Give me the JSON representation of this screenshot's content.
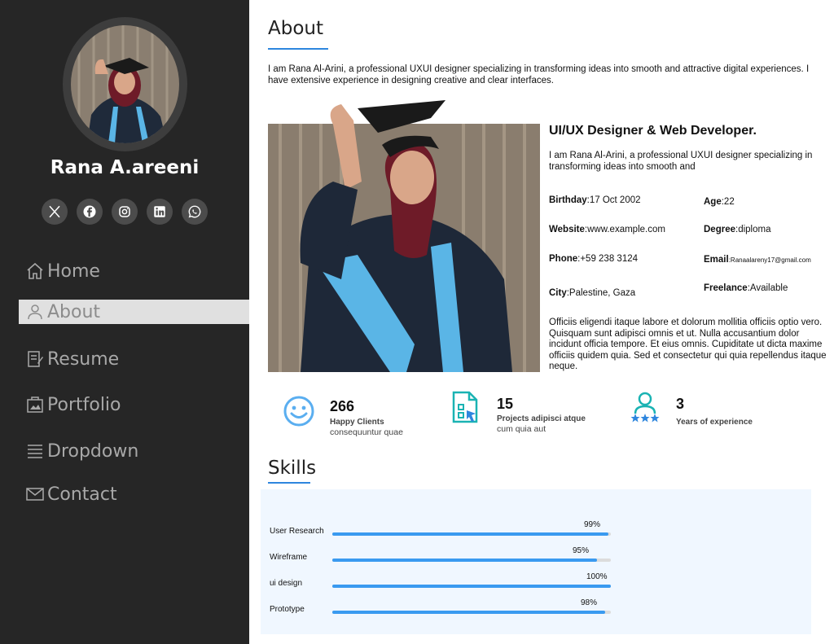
{
  "profile": {
    "name": "Rana A.areeni",
    "socials": [
      "x-icon",
      "facebook-icon",
      "instagram-icon",
      "linkedin-icon",
      "whatsapp-icon"
    ]
  },
  "nav": [
    {
      "label": "Home",
      "icon": "home-icon"
    },
    {
      "label": "About",
      "icon": "user-icon",
      "active": true
    },
    {
      "label": "Resume",
      "icon": "resume-icon"
    },
    {
      "label": "Portfolio",
      "icon": "portfolio-icon"
    },
    {
      "label": "Dropdown",
      "icon": "menu-icon"
    },
    {
      "label": "Contact",
      "icon": "envelope-icon"
    }
  ],
  "about": {
    "title": "About",
    "intro": "I am Rana Al-Arini, a professional UXUI designer specializing in transforming ideas into smooth and attractive digital experiences. I have extensive experience in designing creative and clear interfaces.",
    "role": "UI/UX Designer & Web Developer.",
    "role_desc": "I am Rana Al-Arini, a professional UXUI designer specializing in transforming ideas into smooth and",
    "details": {
      "birthday_label": "Birthday",
      "birthday": ":17 Oct 2002",
      "age_label": "Age",
      "age": ":22",
      "website_label": "Website",
      "website": ":www.example.com",
      "degree_label": "Degree",
      "degree": ":diploma",
      "phone_label": "Phone",
      "phone": ":+59 238 3124",
      "email_label": "Email",
      "email": ":Ranaalareny17@gmail.com",
      "city_label": "City",
      "city": ":Palestine, Gaza",
      "freelance_label": "Freelance",
      "freelance": ":Available"
    },
    "paragraph": "Officiis eligendi itaque labore et dolorum mollitia officiis optio vero. Quisquam sunt adipisci omnis et ut. Nulla accusantium dolor incidunt officia tempore. Et eius omnis. Cupiditate ut dicta maxime officiis quidem quia. Sed et consectetur qui quia repellendus itaque neque."
  },
  "stats": [
    {
      "number": "266",
      "label": "Happy Clients",
      "sub": "consequuntur quae",
      "icon": "smiley-icon"
    },
    {
      "number": "15",
      "label": "Projects adipisci atque",
      "sub": "cum quia aut",
      "icon": "project-icon"
    },
    {
      "number": "3",
      "label": "Years of experience",
      "sub": "",
      "icon": "award-icon"
    }
  ],
  "skills": {
    "title": "Skills",
    "items": [
      {
        "name": "User Research",
        "percent": 99,
        "label": "99%"
      },
      {
        "name": "Wireframe",
        "percent": 95,
        "label": "95%"
      },
      {
        "name": "ui design",
        "percent": 100,
        "label": "100%"
      },
      {
        "name": "Prototype",
        "percent": 98,
        "label": "98%"
      }
    ]
  },
  "colors": {
    "accent": "#2e86de",
    "sidebar": "#262626",
    "skill_bar": "#3a9af0",
    "skills_bg": "#f0f7ff"
  }
}
